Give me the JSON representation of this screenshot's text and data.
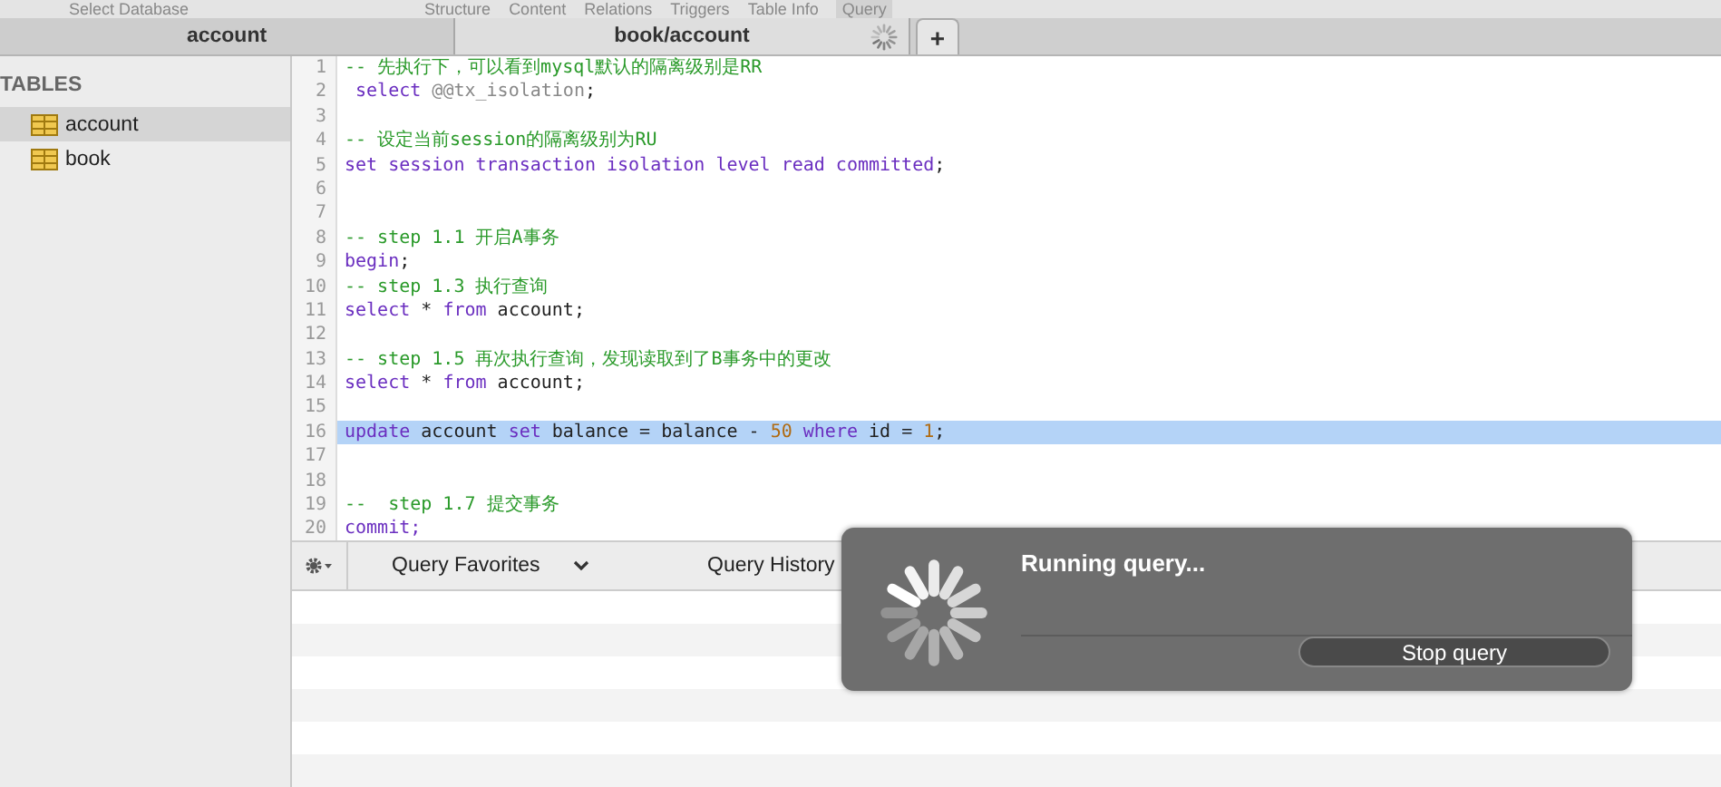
{
  "toolbar": {
    "items": [
      {
        "label": "Select Database",
        "selected": false
      },
      {
        "label": "Structure",
        "selected": false
      },
      {
        "label": "Content",
        "selected": false
      },
      {
        "label": "Relations",
        "selected": false
      },
      {
        "label": "Triggers",
        "selected": false
      },
      {
        "label": "Table Info",
        "selected": false
      },
      {
        "label": "Query",
        "selected": true
      }
    ]
  },
  "tabs": [
    {
      "label": "account",
      "selected": false
    },
    {
      "label": "book/account",
      "selected": true,
      "loading": true
    }
  ],
  "new_tab_button": "+",
  "sidebar": {
    "heading": "TABLES",
    "items": [
      {
        "label": "account",
        "selected": true
      },
      {
        "label": "book",
        "selected": false
      }
    ]
  },
  "editor": {
    "lines": [
      {
        "number": "1",
        "selected": false,
        "tokens": [
          {
            "kind": "comment",
            "text": "-- 先执行下，可以看到mysql默认的隔离级别是RR"
          }
        ]
      },
      {
        "number": "2",
        "selected": false,
        "tokens": [
          {
            "kind": "keyword",
            "text": " select"
          },
          {
            "kind": "variable",
            "text": " @@tx_isolation"
          },
          {
            "kind": "plain",
            "text": ";"
          }
        ]
      },
      {
        "number": "3",
        "selected": false
      },
      {
        "number": "4",
        "selected": false,
        "tokens": [
          {
            "kind": "comment",
            "text": "-- 设定当前session的隔离级别为RU"
          }
        ]
      },
      {
        "number": "5",
        "selected": false,
        "tokens": [
          {
            "kind": "keyword",
            "text": "set session transaction isolation level read committed"
          },
          {
            "kind": "plain",
            "text": ";"
          }
        ]
      },
      {
        "number": "6",
        "selected": false
      },
      {
        "number": "7",
        "selected": false
      },
      {
        "number": "8",
        "selected": false,
        "tokens": [
          {
            "kind": "comment",
            "text": "-- step 1.1 开启A事务"
          }
        ]
      },
      {
        "number": "9",
        "selected": false,
        "tokens": [
          {
            "kind": "keyword",
            "text": "begin"
          },
          {
            "kind": "plain",
            "text": ";"
          }
        ]
      },
      {
        "number": "10",
        "selected": false,
        "tokens": [
          {
            "kind": "comment",
            "text": "-- step 1.3 执行查询"
          }
        ]
      },
      {
        "number": "11",
        "selected": false,
        "tokens": [
          {
            "kind": "keyword",
            "text": "select"
          },
          {
            "kind": "plain",
            "text": " * "
          },
          {
            "kind": "keyword",
            "text": "from"
          },
          {
            "kind": "plain",
            "text": " account;"
          }
        ]
      },
      {
        "number": "12",
        "selected": false
      },
      {
        "number": "13",
        "selected": false,
        "tokens": [
          {
            "kind": "comment",
            "text": "-- step 1.5 再次执行查询，发现读取到了B事务中的更改"
          }
        ]
      },
      {
        "number": "14",
        "selected": false,
        "tokens": [
          {
            "kind": "keyword",
            "text": "select"
          },
          {
            "kind": "plain",
            "text": " * "
          },
          {
            "kind": "keyword",
            "text": "from"
          },
          {
            "kind": "plain",
            "text": " account;"
          }
        ]
      },
      {
        "number": "15",
        "selected": false
      },
      {
        "number": "16",
        "selected": true,
        "tokens": [
          {
            "kind": "keyword",
            "text": "update"
          },
          {
            "kind": "plain",
            "text": " account "
          },
          {
            "kind": "keyword",
            "text": "set"
          },
          {
            "kind": "plain",
            "text": " balance = balance - "
          },
          {
            "kind": "number",
            "text": "50"
          },
          {
            "kind": "keyword",
            "text": " where"
          },
          {
            "kind": "plain",
            "text": " id = "
          },
          {
            "kind": "number",
            "text": "1"
          },
          {
            "kind": "plain",
            "text": ";"
          }
        ]
      },
      {
        "number": "17",
        "selected": false
      },
      {
        "number": "18",
        "selected": false
      },
      {
        "number": "19",
        "selected": false,
        "tokens": [
          {
            "kind": "comment",
            "text": "--  step 1.7 提交事务"
          }
        ]
      },
      {
        "number": "20",
        "selected": false,
        "tokens": [
          {
            "kind": "keyword",
            "text": "commit;"
          }
        ]
      }
    ]
  },
  "bottom_bar": {
    "favorites": "Query Favorites",
    "history": "Query History"
  },
  "progress_dialog": {
    "message": "Running query...",
    "button": "Stop query"
  }
}
